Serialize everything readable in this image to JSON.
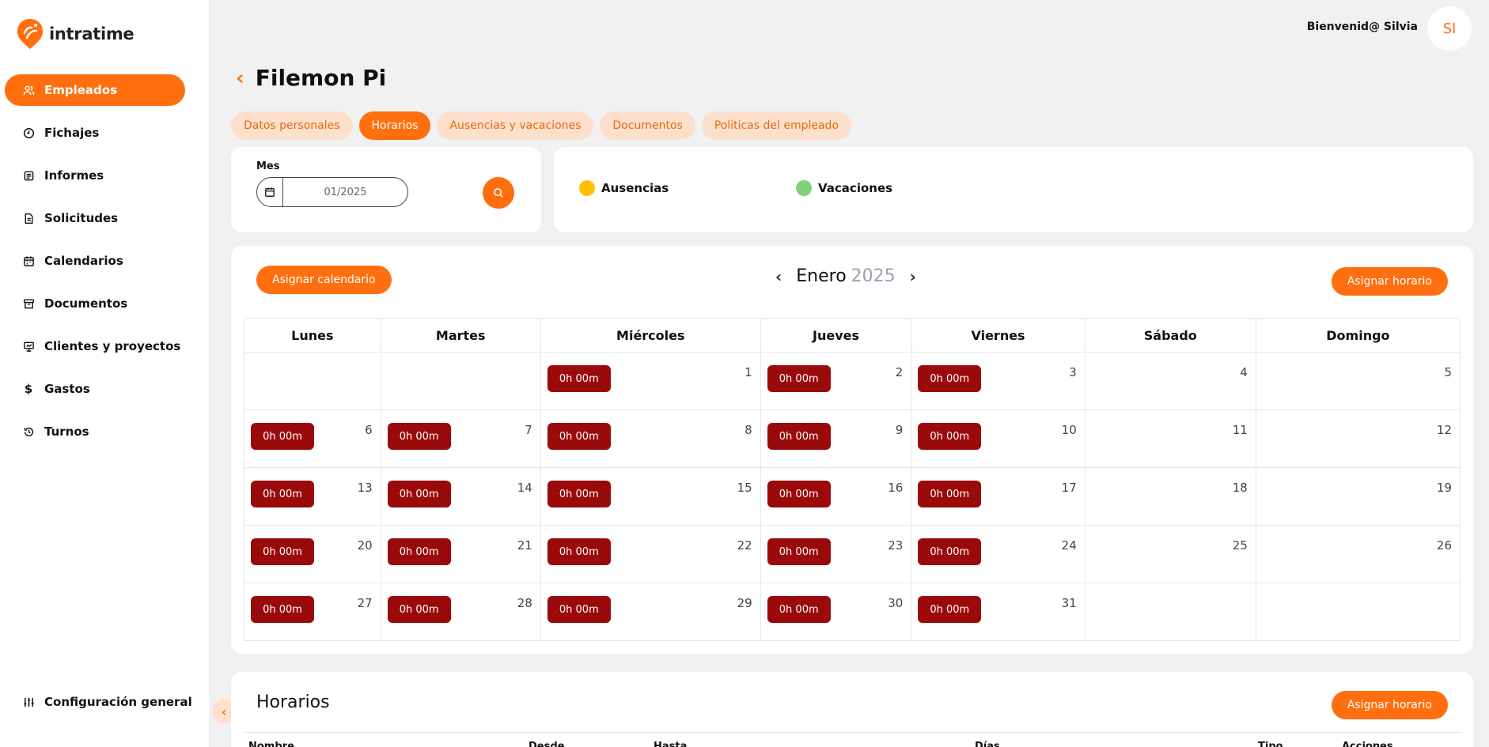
{
  "app": {
    "logo_text": "intratime",
    "brand_color": "#ff6f0f",
    "welcome": "Bienvenid@ Silvia",
    "avatar_initials": "SI"
  },
  "sidebar": {
    "items": [
      {
        "label": "Empleados",
        "icon": "users-icon",
        "active": true
      },
      {
        "label": "Fichajes",
        "icon": "clock-icon"
      },
      {
        "label": "Informes",
        "icon": "report-icon"
      },
      {
        "label": "Solicitudes",
        "icon": "document-icon"
      },
      {
        "label": "Calendarios",
        "icon": "calendar-icon"
      },
      {
        "label": "Documentos",
        "icon": "archive-icon"
      },
      {
        "label": "Clientes y proyectos",
        "icon": "presentation-icon"
      },
      {
        "label": "Gastos",
        "icon": "dollar-icon"
      },
      {
        "label": "Turnos",
        "icon": "history-icon"
      }
    ],
    "config_label": "Configuración general"
  },
  "page": {
    "title": "Filemon Pi",
    "tabs": [
      {
        "label": "Datos personales",
        "active": false
      },
      {
        "label": "Horarios",
        "active": true
      },
      {
        "label": "Ausencias y vacaciones",
        "active": false
      },
      {
        "label": "Documentos",
        "active": false
      },
      {
        "label": "Politicas del empleado",
        "active": false
      }
    ]
  },
  "filter": {
    "label": "Mes",
    "value": "01/2025"
  },
  "legend": [
    {
      "label": "Ausencias",
      "color": "#ffc107"
    },
    {
      "label": "Vacaciones",
      "color": "#7ed07a"
    }
  ],
  "calendar": {
    "assign_calendar_label": "Asignar calendario",
    "assign_schedule_label": "Asignar horario",
    "month": "Enero",
    "year": "2025",
    "badge_color": "#9b0a0a",
    "weekdays": [
      "Lunes",
      "Martes",
      "Miércoles",
      "Jueves",
      "Viernes",
      "Sábado",
      "Domingo"
    ],
    "weeks": [
      [
        null,
        null,
        {
          "day": "1",
          "hours": "0h 00m"
        },
        {
          "day": "2",
          "hours": "0h 00m"
        },
        {
          "day": "3",
          "hours": "0h 00m"
        },
        {
          "day": "4"
        },
        {
          "day": "5"
        }
      ],
      [
        {
          "day": "6",
          "hours": "0h 00m"
        },
        {
          "day": "7",
          "hours": "0h 00m"
        },
        {
          "day": "8",
          "hours": "0h 00m"
        },
        {
          "day": "9",
          "hours": "0h 00m"
        },
        {
          "day": "10",
          "hours": "0h 00m"
        },
        {
          "day": "11"
        },
        {
          "day": "12"
        }
      ],
      [
        {
          "day": "13",
          "hours": "0h 00m"
        },
        {
          "day": "14",
          "hours": "0h 00m"
        },
        {
          "day": "15",
          "hours": "0h 00m"
        },
        {
          "day": "16",
          "hours": "0h 00m"
        },
        {
          "day": "17",
          "hours": "0h 00m"
        },
        {
          "day": "18"
        },
        {
          "day": "19"
        }
      ],
      [
        {
          "day": "20",
          "hours": "0h 00m"
        },
        {
          "day": "21",
          "hours": "0h 00m"
        },
        {
          "day": "22",
          "hours": "0h 00m"
        },
        {
          "day": "23",
          "hours": "0h 00m"
        },
        {
          "day": "24",
          "hours": "0h 00m"
        },
        {
          "day": "25"
        },
        {
          "day": "26"
        }
      ],
      [
        {
          "day": "27",
          "hours": "0h 00m"
        },
        {
          "day": "28",
          "hours": "0h 00m"
        },
        {
          "day": "29",
          "hours": "0h 00m"
        },
        {
          "day": "30",
          "hours": "0h 00m"
        },
        {
          "day": "31",
          "hours": "0h 00m"
        },
        null,
        null
      ]
    ]
  },
  "horarios": {
    "title": "Horarios",
    "assign_label": "Asignar horario",
    "columns": [
      "Nombre",
      "Desde",
      "Hasta",
      "Días",
      "Tipo",
      "Acciones"
    ]
  }
}
